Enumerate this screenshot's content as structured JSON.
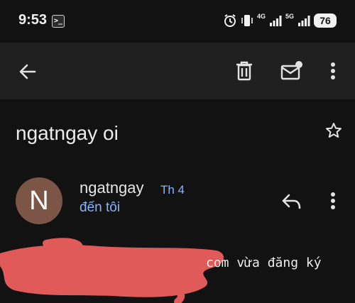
{
  "status_bar": {
    "time": "9:53",
    "network_4g": "4G",
    "network_5g": "5G",
    "battery": "76"
  },
  "toolbar": {
    "icons": [
      "back-arrow-icon",
      "trash-icon",
      "mark-unread-icon",
      "more-vert-icon"
    ]
  },
  "email": {
    "subject": "ngatngay oi",
    "sender": "ngatngay",
    "avatar_letter": "N",
    "date": "Th 4",
    "recipient": "đến tôi",
    "body_visible": "com vừa đăng ký"
  },
  "colors": {
    "background": "#121212",
    "toolbar": "#202020",
    "avatar": "#7b5546",
    "link_blue": "#8ab4f8",
    "redaction": "#e05a5a"
  }
}
